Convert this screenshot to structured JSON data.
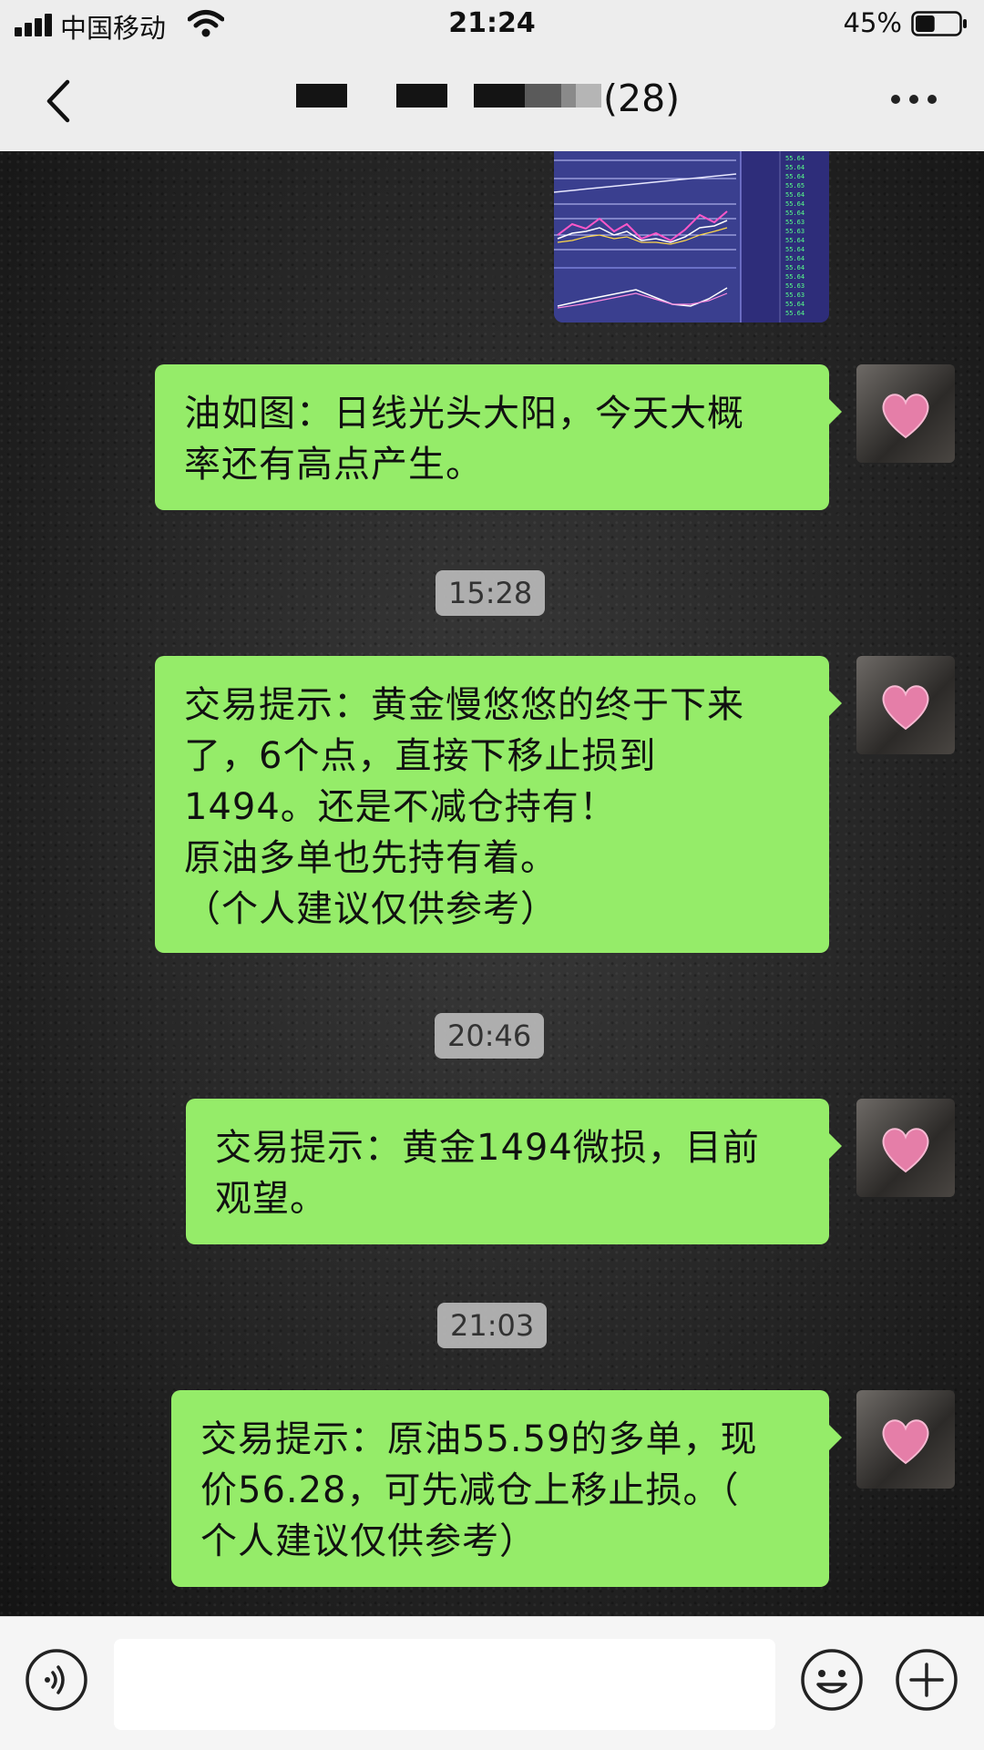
{
  "status_bar": {
    "carrier": "中国移动",
    "time": "21:24",
    "battery": "45%",
    "battery_level": 0.45
  },
  "nav": {
    "title_count": "(28)",
    "back_icon": "chevron-left-icon",
    "more_icon": "more-dots-icon"
  },
  "messages": [
    {
      "type": "image",
      "description_icon": "stock-chart-image"
    },
    {
      "type": "text",
      "lines": [
        "油如图：日线光头大阳，今天大概",
        "率还有高点产生。"
      ]
    },
    {
      "type": "time",
      "text": "15:28"
    },
    {
      "type": "text",
      "lines": [
        "交易提示：黄金慢悠悠的终于下来",
        "了，6个点，直接下移止损到",
        "1494。还是不减仓持有！",
        "原油多单也先持有着。",
        "（个人建议仅供参考）"
      ]
    },
    {
      "type": "time",
      "text": "20:46"
    },
    {
      "type": "text",
      "lines": [
        "交易提示：黄金1494微损，目前",
        "观望。"
      ]
    },
    {
      "type": "time",
      "text": "21:03"
    },
    {
      "type": "text",
      "lines": [
        "交易提示：原油55.59的多单，现",
        "价56.28，可先减仓上移止损。（",
        "个人建议仅供参考）"
      ]
    }
  ],
  "input_bar": {
    "voice_icon": "voice-icon",
    "emoji_icon": "emoji-icon",
    "plus_icon": "plus-icon",
    "input_value": ""
  },
  "colors": {
    "bubble": "#95ec69",
    "nav_bg": "#ededed",
    "chart_bg": "#2f2f7c"
  }
}
